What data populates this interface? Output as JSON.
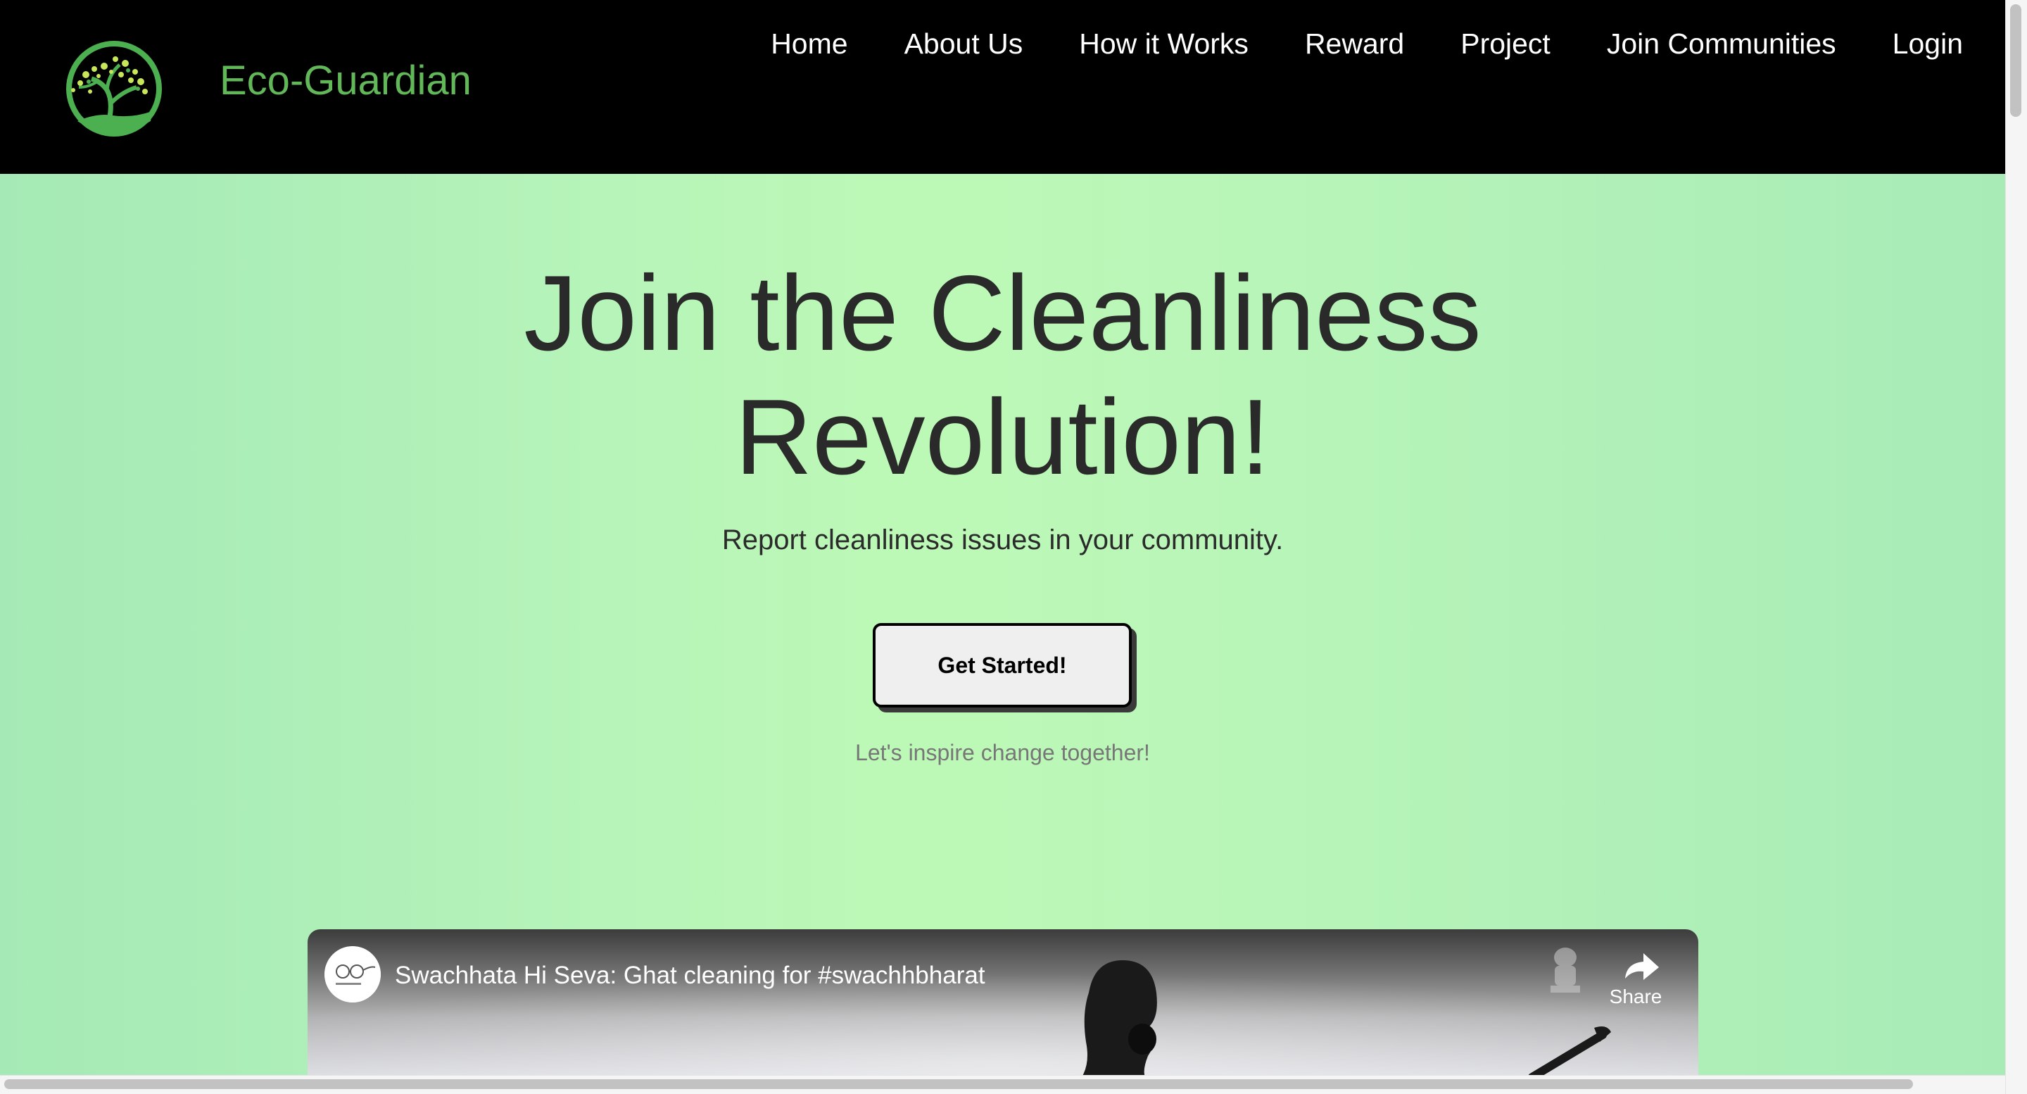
{
  "header": {
    "brand": "Eco-Guardian",
    "logo_icon": "tree-logo-icon",
    "nav": [
      {
        "label": "Home"
      },
      {
        "label": "About Us"
      },
      {
        "label": "How it Works"
      },
      {
        "label": "Reward"
      },
      {
        "label": "Project"
      },
      {
        "label": "Join Communities"
      },
      {
        "label": "Login"
      }
    ]
  },
  "hero": {
    "title_line1": "Join the Cleanliness",
    "title_line2": "Revolution!",
    "subtitle": "Report cleanliness issues in your community.",
    "cta_label": "Get Started!",
    "cta_caption": "Let's inspire change together!"
  },
  "video": {
    "title": "Swachhata Hi Seva: Ghat cleaning for #swachhbharat",
    "share_label": "Share",
    "channel_avatar_icon": "channel-avatar-icon",
    "share_icon": "share-arrow-icon"
  },
  "colors": {
    "header_bg": "#000000",
    "brand": "#62b859",
    "hero_bg": "#bdf9b6",
    "title_text": "#2a2a2a",
    "caption_text": "#777777"
  }
}
